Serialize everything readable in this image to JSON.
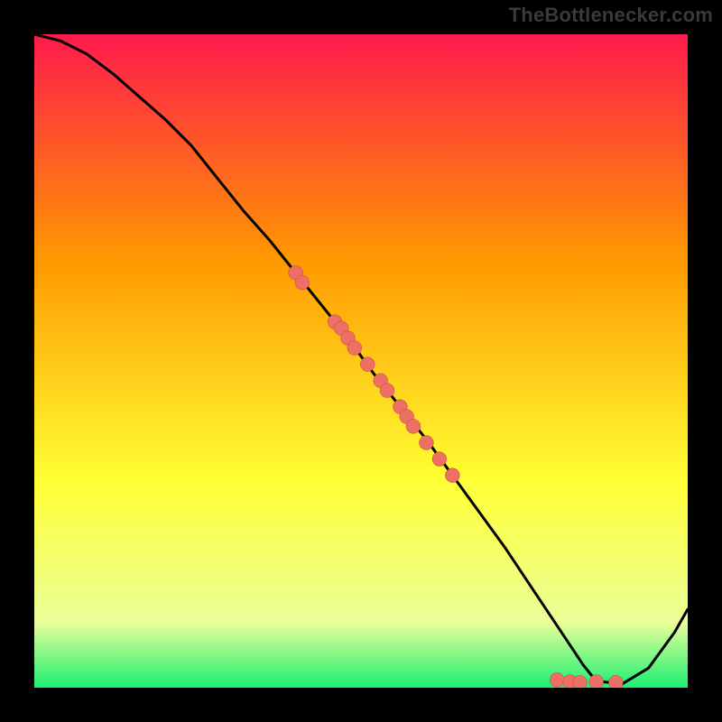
{
  "watermark": "TheBottlenecker.com",
  "colors": {
    "bg_black": "#000000",
    "curve": "#000000",
    "marker_fill": "#ec7063",
    "marker_stroke": "#cb4336",
    "grad_top": "#ff1a4d",
    "grad_mid_orange": "#ff9a00",
    "grad_yellow": "#ffff33",
    "grad_pale": "#eaff99",
    "grad_green": "#1cef73"
  },
  "chart_data": {
    "type": "line",
    "title": "",
    "xlabel": "",
    "ylabel": "",
    "xlim": [
      0,
      100
    ],
    "ylim": [
      0,
      100
    ],
    "curve": {
      "x": [
        0,
        4,
        8,
        12,
        16,
        20,
        24,
        28,
        32,
        36,
        40,
        44,
        48,
        52,
        56,
        60,
        64,
        68,
        72,
        76,
        80,
        84,
        86,
        90,
        94,
        98,
        100
      ],
      "y": [
        100,
        99,
        97,
        94,
        90.5,
        87,
        83,
        78,
        73,
        68.5,
        63.5,
        58.5,
        53.5,
        48,
        43,
        38,
        32.5,
        27,
        21.5,
        15.5,
        9.5,
        3.5,
        1,
        0.6,
        3,
        8.5,
        12
      ]
    },
    "markers": [
      {
        "x": 40,
        "y": 63.5
      },
      {
        "x": 41,
        "y": 62
      },
      {
        "x": 46,
        "y": 56
      },
      {
        "x": 47,
        "y": 55
      },
      {
        "x": 48,
        "y": 53.5
      },
      {
        "x": 49,
        "y": 52
      },
      {
        "x": 51,
        "y": 49.5
      },
      {
        "x": 53,
        "y": 47
      },
      {
        "x": 54,
        "y": 45.5
      },
      {
        "x": 56,
        "y": 43
      },
      {
        "x": 57,
        "y": 41.5
      },
      {
        "x": 58,
        "y": 40
      },
      {
        "x": 60,
        "y": 37.5
      },
      {
        "x": 62,
        "y": 35
      },
      {
        "x": 64,
        "y": 32.5
      },
      {
        "x": 80,
        "y": 1.2
      },
      {
        "x": 82,
        "y": 0.9
      },
      {
        "x": 83.5,
        "y": 0.8
      },
      {
        "x": 86,
        "y": 0.9
      },
      {
        "x": 89,
        "y": 0.8
      }
    ],
    "marker_radius_data_units": 1.1
  }
}
